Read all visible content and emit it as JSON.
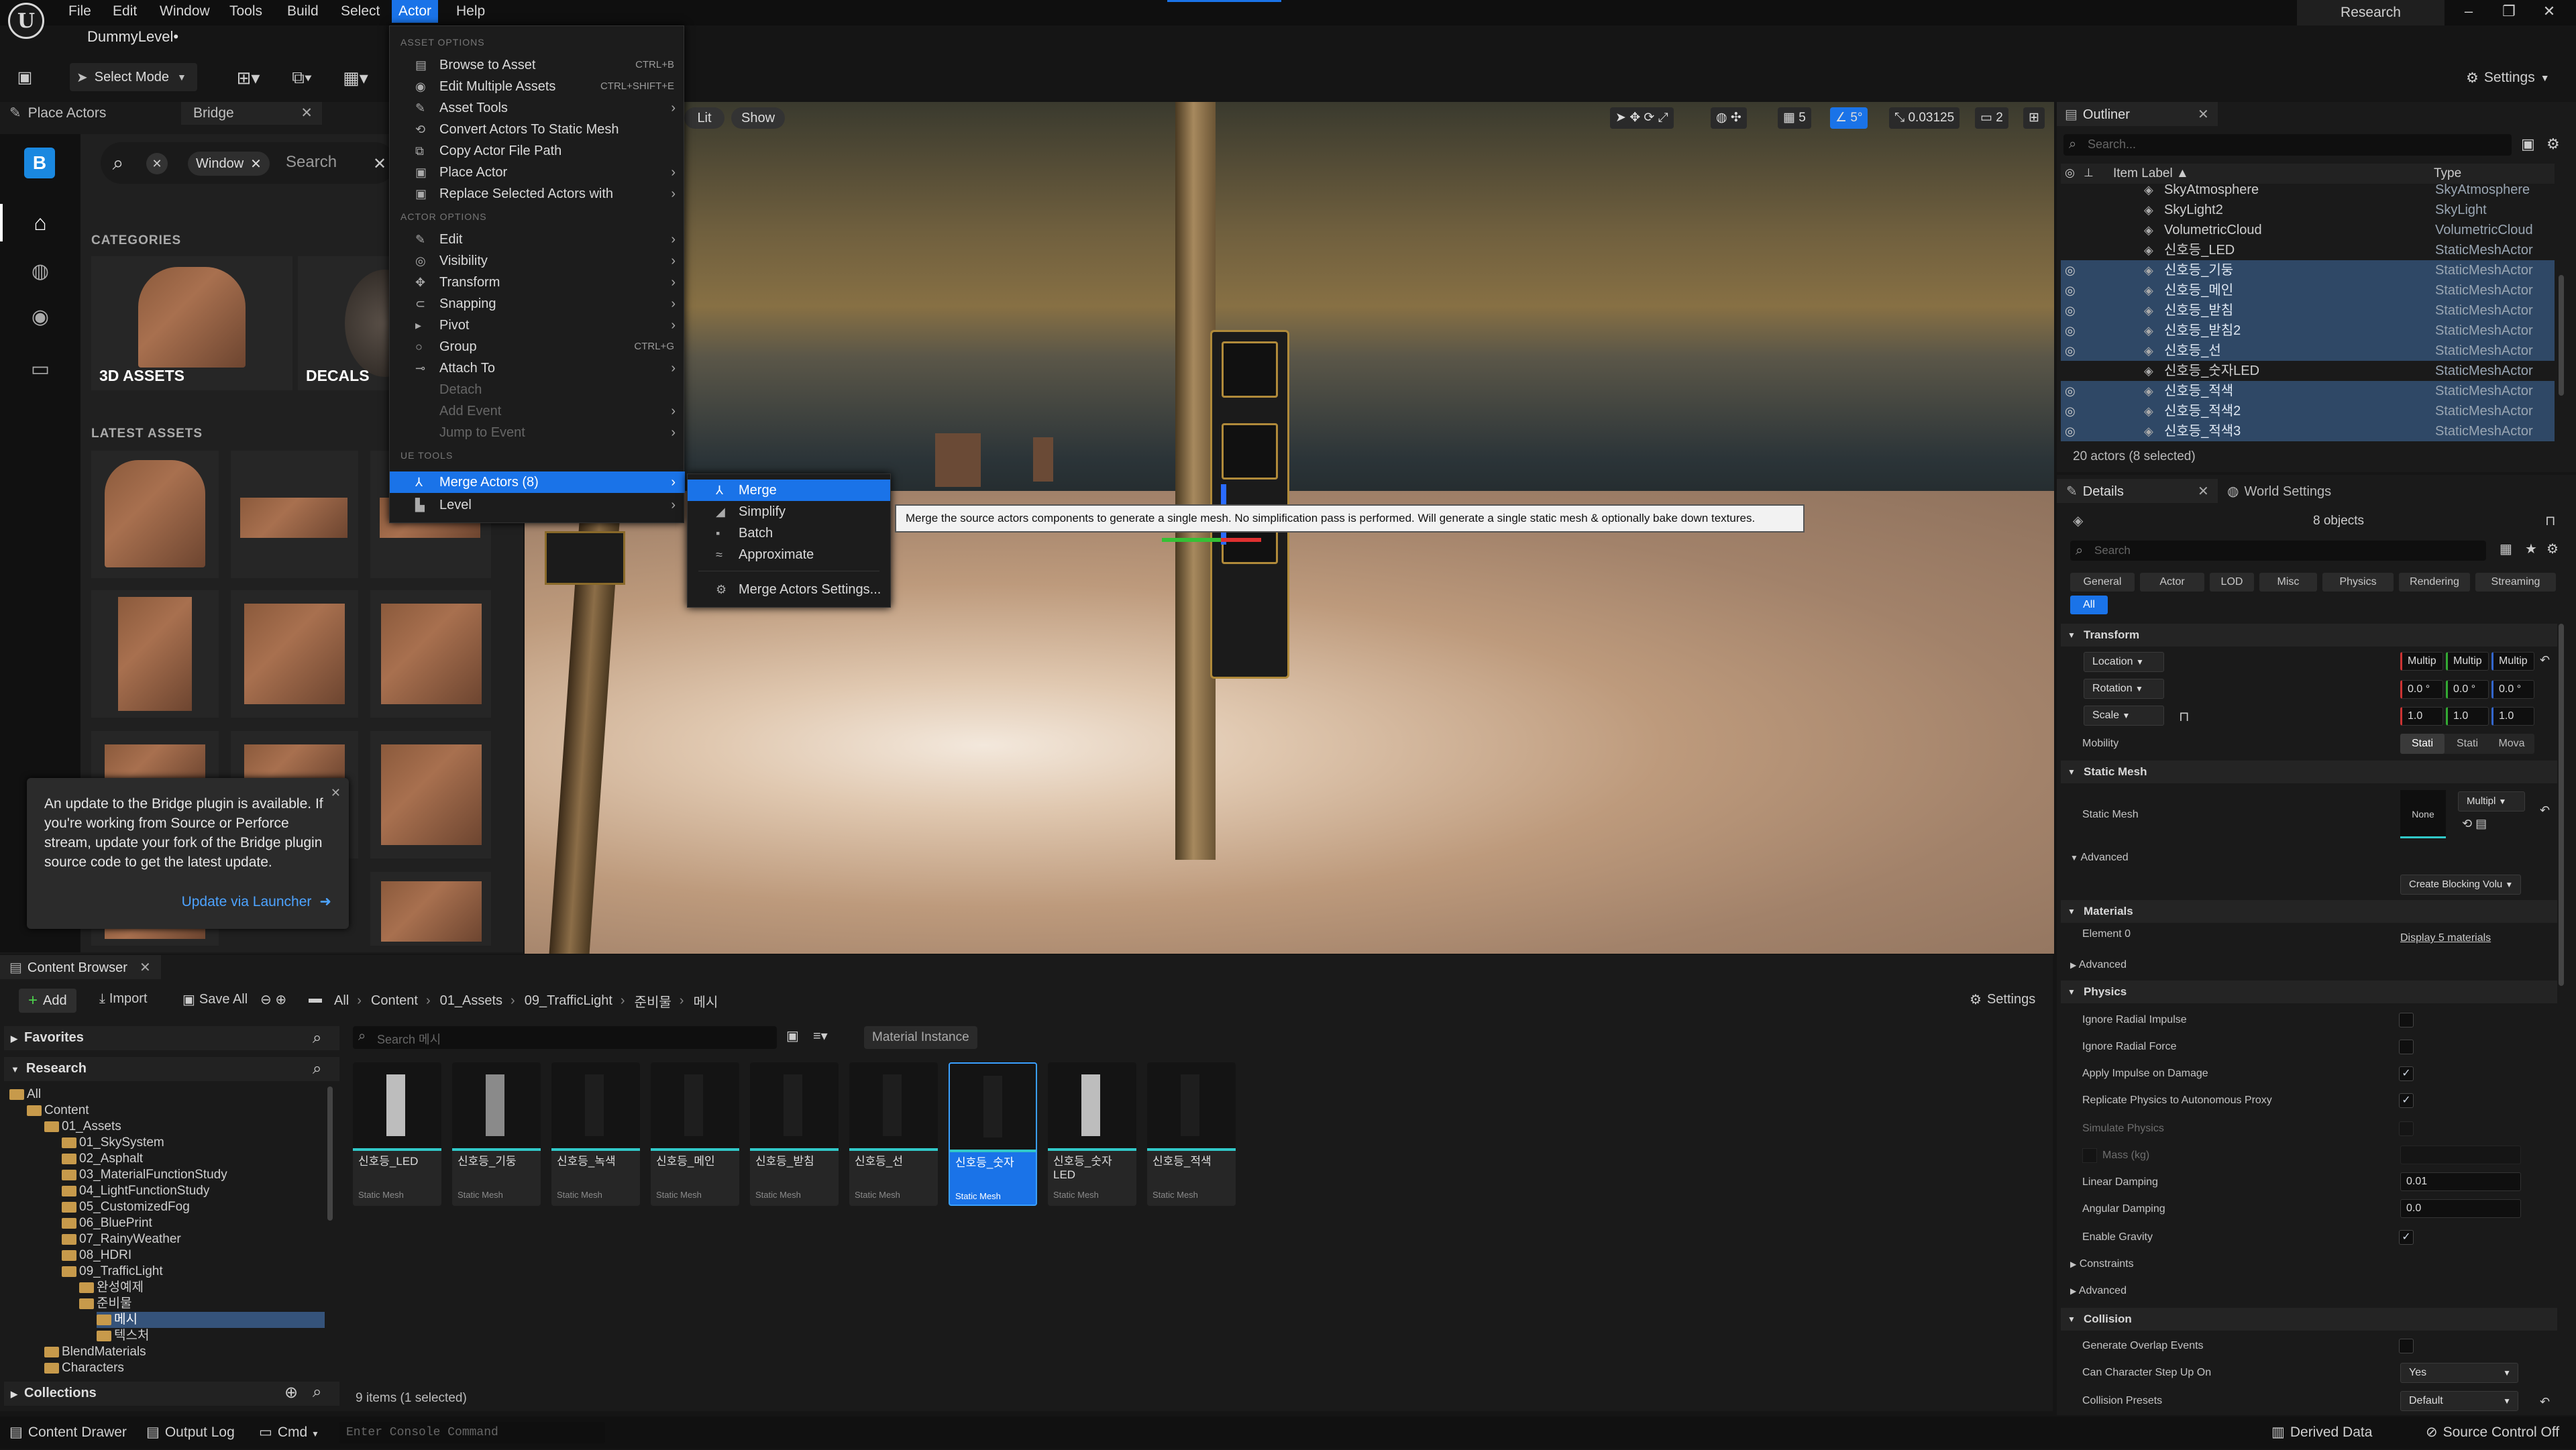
{
  "menubar": {
    "items": [
      "File",
      "Edit",
      "Window",
      "Tools",
      "Build",
      "Select",
      "Actor",
      "Help"
    ],
    "level_name": "DummyLevel•",
    "research_btn": "Research"
  },
  "toolbar": {
    "select_mode": "Select Mode",
    "settings": "Settings"
  },
  "left_panel": {
    "tab_place": "Place Actors",
    "tab_bridge": "Bridge",
    "search_chip": "Window",
    "search_placeholder": "Search",
    "categories_title": "CATEGORIES",
    "cat_3d": "3D ASSETS",
    "cat_decals": "DECALS",
    "latest_title": "LATEST ASSETS",
    "toast_text": "An update to the Bridge plugin is available. If you're working from Source or Perforce stream, update your fork of the Bridge plugin source code to get the latest update.",
    "toast_link": "Update via Launcher"
  },
  "viewport": {
    "lit": "Lit",
    "show": "Show",
    "grid": "5",
    "angle": "5°",
    "scale": "0.03125",
    "camera": "2"
  },
  "actor_menu": {
    "h_asset": "ASSET OPTIONS",
    "browse": "Browse to Asset",
    "browse_sc": "CTRL+B",
    "edit_multi": "Edit Multiple Assets",
    "edit_multi_sc": "CTRL+SHIFT+E",
    "asset_tools": "Asset Tools",
    "convert": "Convert Actors To Static Mesh",
    "copy_path": "Copy Actor File Path",
    "place_actor": "Place Actor",
    "replace": "Replace Selected Actors with",
    "h_actor": "ACTOR OPTIONS",
    "edit": "Edit",
    "visibility": "Visibility",
    "transform": "Transform",
    "snapping": "Snapping",
    "pivot": "Pivot",
    "group": "Group",
    "group_sc": "CTRL+G",
    "attach": "Attach To",
    "detach": "Detach",
    "add_event": "Add Event",
    "jump_event": "Jump to Event",
    "h_ue": "UE TOOLS",
    "merge_actors": "Merge Actors (8)",
    "level": "Level"
  },
  "submenu": {
    "merge": "Merge",
    "simplify": "Simplify",
    "batch": "Batch",
    "approximate": "Approximate",
    "settings": "Merge Actors Settings..."
  },
  "tooltip": "Merge the source actors components to generate a single mesh. No simplification pass is performed. Will generate a single static mesh & optionally bake down textures.",
  "outliner": {
    "title": "Outliner",
    "search_placeholder": "Search...",
    "col_label": "Item Label ▲",
    "col_type": "Type",
    "rows": [
      {
        "name": "SkyAtmosphere",
        "type": "SkyAtmosphere",
        "sel": false
      },
      {
        "name": "SkyLight2",
        "type": "SkyLight",
        "sel": false
      },
      {
        "name": "VolumetricCloud",
        "type": "VolumetricCloud",
        "sel": false
      },
      {
        "name": "신호등_LED",
        "type": "StaticMeshActor",
        "sel": false
      },
      {
        "name": "신호등_기둥",
        "type": "StaticMeshActor",
        "sel": true
      },
      {
        "name": "신호등_메인",
        "type": "StaticMeshActor",
        "sel": true
      },
      {
        "name": "신호등_받침",
        "type": "StaticMeshActor",
        "sel": true
      },
      {
        "name": "신호등_받침2",
        "type": "StaticMeshActor",
        "sel": true
      },
      {
        "name": "신호등_선",
        "type": "StaticMeshActor",
        "sel": true
      },
      {
        "name": "신호등_숫자LED",
        "type": "StaticMeshActor",
        "sel": false
      },
      {
        "name": "신호등_적색",
        "type": "StaticMeshActor",
        "sel": true
      },
      {
        "name": "신호등_적색2",
        "type": "StaticMeshActor",
        "sel": true
      },
      {
        "name": "신호등_적색3",
        "type": "StaticMeshActor",
        "sel": true
      }
    ],
    "count": "20 actors (8 selected)"
  },
  "details": {
    "tab_details": "Details",
    "tab_world": "World Settings",
    "objects": "8 objects",
    "search_placeholder": "Search",
    "filters": [
      "General",
      "Actor",
      "LOD",
      "Misc",
      "Physics",
      "Rendering",
      "Streaming",
      "All"
    ],
    "sec_transform": "Transform",
    "location": "Location",
    "rotation": "Rotation",
    "scale": "Scale",
    "multi": "Multip",
    "zero": "0.0 °",
    "one": "1.0",
    "mobility": "Mobility",
    "mob_static": "Stati",
    "mob_stationary": "Stati",
    "mob_movable": "Mova",
    "sec_static_mesh": "Static Mesh",
    "static_mesh_label": "Static Mesh",
    "none": "None",
    "multiple": "Multipl",
    "advanced": "Advanced",
    "create_blocking": "Create Blocking Volu",
    "sec_materials": "Materials",
    "element0": "Element 0",
    "display_materials": "Display 5 materials",
    "sec_physics": "Physics",
    "ignore_radial_impulse": "Ignore Radial Impulse",
    "ignore_radial_force": "Ignore Radial Force",
    "apply_impulse": "Apply Impulse on Damage",
    "replicate_physics": "Replicate Physics to Autonomous Proxy",
    "simulate_physics": "Simulate Physics",
    "mass": "Mass (kg)",
    "linear_damping": "Linear Damping",
    "linear_val": "0.01",
    "angular_damping": "Angular Damping",
    "angular_val": "0.0",
    "enable_gravity": "Enable Gravity",
    "constraints": "Constraints",
    "sec_collision": "Collision",
    "gen_overlap": "Generate Overlap Events",
    "step_up": "Can Character Step Up On",
    "step_up_val": "Yes",
    "presets": "Collision Presets",
    "presets_val": "Default"
  },
  "content_browser": {
    "tab": "Content Browser",
    "add": "Add",
    "import": "Import",
    "save_all": "Save All",
    "crumbs": [
      "All",
      "Content",
      "01_Assets",
      "09_TrafficLight",
      "준비물",
      "메시"
    ],
    "settings": "Settings",
    "favorites": "Favorites",
    "research": "Research",
    "collections": "Collections",
    "search_placeholder": "Search 메시",
    "filter_chip": "Material Instance",
    "tree": [
      {
        "label": "All",
        "depth": 0
      },
      {
        "label": "Content",
        "depth": 1
      },
      {
        "label": "01_Assets",
        "depth": 2
      },
      {
        "label": "01_SkySystem",
        "depth": 3
      },
      {
        "label": "02_Asphalt",
        "depth": 3
      },
      {
        "label": "03_MaterialFunctionStudy",
        "depth": 3
      },
      {
        "label": "04_LightFunctionStudy",
        "depth": 3
      },
      {
        "label": "05_CustomizedFog",
        "depth": 3
      },
      {
        "label": "06_BluePrint",
        "depth": 3
      },
      {
        "label": "07_RainyWeather",
        "depth": 3
      },
      {
        "label": "08_HDRI",
        "depth": 3
      },
      {
        "label": "09_TrafficLight",
        "depth": 3
      },
      {
        "label": "완성예제",
        "depth": 4
      },
      {
        "label": "준비물",
        "depth": 4
      },
      {
        "label": "메시",
        "depth": 5
      },
      {
        "label": "텍스처",
        "depth": 5
      },
      {
        "label": "BlendMaterials",
        "depth": 2
      },
      {
        "label": "Characters",
        "depth": 2
      }
    ],
    "assets": [
      {
        "name": "신호등_LED",
        "type": "Static Mesh"
      },
      {
        "name": "신호등_기둥",
        "type": "Static Mesh"
      },
      {
        "name": "신호등_녹색",
        "type": "Static Mesh"
      },
      {
        "name": "신호등_메인",
        "type": "Static Mesh"
      },
      {
        "name": "신호등_받침",
        "type": "Static Mesh"
      },
      {
        "name": "신호등_선",
        "type": "Static Mesh"
      },
      {
        "name": "신호등_숫자",
        "type": "Static Mesh"
      },
      {
        "name": "신호등_숫자LED",
        "type": "Static Mesh"
      },
      {
        "name": "신호등_적색",
        "type": "Static Mesh"
      }
    ],
    "item_count": "9 items (1 selected)"
  },
  "statusbar": {
    "drawer": "Content Drawer",
    "output_log": "Output Log",
    "cmd": "Cmd",
    "console_placeholder": "Enter Console Command",
    "derived": "Derived Data",
    "source": "Source Control Off"
  }
}
